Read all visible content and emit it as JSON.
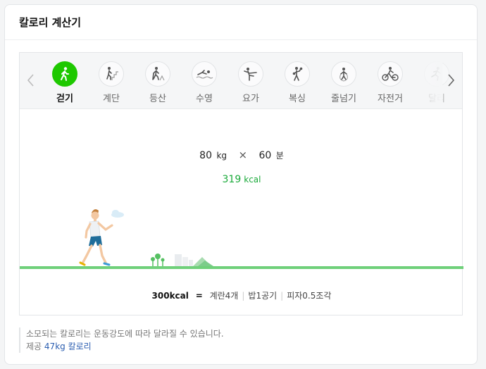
{
  "header": {
    "title": "칼로리 계산기"
  },
  "tabs": [
    {
      "label": "걷기",
      "icon": "walking-icon",
      "active": true
    },
    {
      "label": "계단",
      "icon": "stairs-icon"
    },
    {
      "label": "등산",
      "icon": "hiking-icon"
    },
    {
      "label": "수영",
      "icon": "swimming-icon"
    },
    {
      "label": "요가",
      "icon": "yoga-icon"
    },
    {
      "label": "복싱",
      "icon": "boxing-icon"
    },
    {
      "label": "줄넘기",
      "icon": "jump-rope-icon"
    },
    {
      "label": "자전거",
      "icon": "bicycle-icon"
    },
    {
      "label": "달리",
      "icon": "running-icon"
    }
  ],
  "formula": {
    "weight": "80",
    "weight_unit": "kg",
    "times": "×",
    "minutes": "60",
    "minutes_unit": "분"
  },
  "result": {
    "value": "319",
    "unit": "kcal"
  },
  "equivalent": {
    "kcal": "300kcal",
    "eq": "=",
    "items": [
      "계란4개",
      "밥1공기",
      "피자0.5조각"
    ]
  },
  "notes": {
    "line1": "소모되는 칼로리는 운동강도에 따라 달라질 수 있습니다.",
    "provider_prefix": "제공",
    "provider_link": "47kg 칼로리"
  },
  "colors": {
    "accent": "#1ec800",
    "result": "#1aaa3a",
    "ground": "#6fd07a"
  }
}
